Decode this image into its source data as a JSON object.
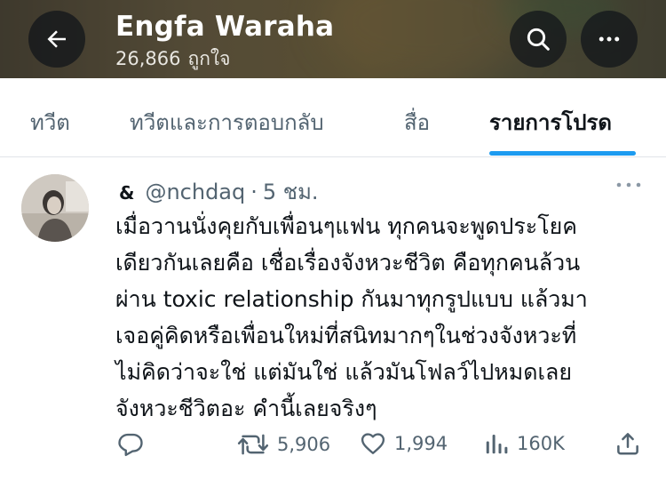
{
  "header": {
    "name": "Engfa Waraha",
    "likes_count": "26,866",
    "likes_label": "ถูกใจ",
    "back_icon": "arrow-left-icon",
    "search_icon": "search-icon",
    "more_icon": "more-horizontal-icon"
  },
  "tabs": [
    {
      "label": "ทวีต",
      "active": false
    },
    {
      "label": "ทวีตและการตอบกลับ",
      "active": false
    },
    {
      "label": "สื่อ",
      "active": false
    },
    {
      "label": "รายการโปรด",
      "active": true
    }
  ],
  "tweet": {
    "display_name": "&",
    "handle": "@nchdaq",
    "separator": "·",
    "time": "5 ชม.",
    "lines": [
      "เมื่อวานนั่งคุยกับเพื่อนๆแฟน ทุกคนจะพูดประโยค",
      "เดียวกันเลยคือ เชื่อเรื่องจังหวะชีวิต คือทุกคนล้วน",
      "ผ่าน toxic relationship กันมาทุกรูปแบบ แล้วมา",
      "เจอคู่คิดหรือเพื่อนใหม่ที่สนิทมากๆในช่วงจังหวะที่",
      "ไม่คิดว่าจะใช่ แต่มันใช่ แล้วมันโฟลว์ไปหมดเลย",
      "จังหวะชีวิตอะ คำนี้เลยจริงๆ"
    ],
    "actions": {
      "reply": {
        "icon": "reply-icon",
        "count": ""
      },
      "retweet": {
        "icon": "retweet-icon",
        "count": "5,906"
      },
      "like": {
        "icon": "heart-icon",
        "count": "1,994"
      },
      "views": {
        "icon": "analytics-icon",
        "count": "160K"
      },
      "share": {
        "icon": "share-icon",
        "count": ""
      }
    }
  },
  "colors": {
    "accent": "#1d9bf0",
    "text_primary": "#0f1419",
    "text_secondary": "#536471"
  }
}
